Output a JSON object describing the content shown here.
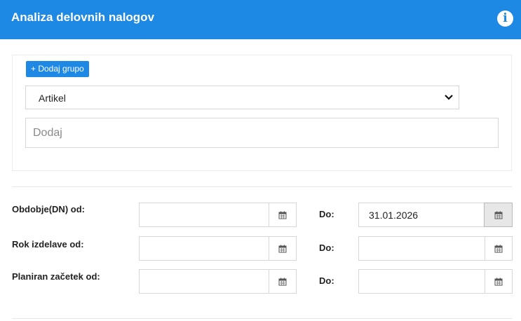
{
  "header": {
    "title": "Analiza delovnih nalogov",
    "info_icon": "info-circle-icon"
  },
  "group": {
    "add_button_label": "+ Dodaj grupo",
    "select_value": "Artikel",
    "add_placeholder": "Dodaj"
  },
  "filters": [
    {
      "label": "Obdobje(DN) od:",
      "from_value": "",
      "to_label": "Do:",
      "to_value": "31.01.2026"
    },
    {
      "label": "Rok izdelave od:",
      "from_value": "",
      "to_label": "Do:",
      "to_value": ""
    },
    {
      "label": "Planiran začetek od:",
      "from_value": "",
      "to_label": "Do:",
      "to_value": ""
    }
  ],
  "colors": {
    "header": "#1e88e5",
    "button": "#1e88e5"
  },
  "icons": {
    "calendar": "calendar-icon",
    "dropdown": "chevron-down-icon"
  }
}
